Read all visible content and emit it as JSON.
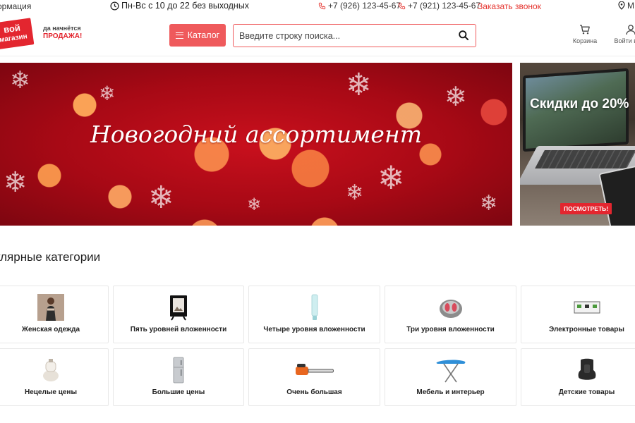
{
  "topbar": {
    "info_link": "ормация",
    "hours": "Пн-Вс с 10 до 22 без выходных",
    "phone1": "+7 (926) 123-45-67",
    "phone2": "+7 (921) 123-45-67",
    "callback": "Заказать звонок",
    "city": "М"
  },
  "header": {
    "logo_line1": "вой",
    "logo_line2": "магазин",
    "slogan_line1": "да начнётся",
    "slogan_line2": "продажа!",
    "catalog_label": "Каталог",
    "search_placeholder": "Введите строку поиска...",
    "cart_label": "Корзина",
    "login_label": "Войти в к"
  },
  "banners": {
    "main_title": "Новогодний ассортимент",
    "side_title": "Скидки до 20%",
    "side_button": "ПОСМОТРЕТЬ!"
  },
  "categories": {
    "title": "улярные категории",
    "items": [
      {
        "label": "Женская одежда",
        "icon": "dress-photo"
      },
      {
        "label": "Пять уровней вложенности",
        "icon": "photo-frame"
      },
      {
        "label": "Четыре уровня вложенности",
        "icon": "cream-tube"
      },
      {
        "label": "Три уровня вложенности",
        "icon": "foot-spa"
      },
      {
        "label": "Электронные товары",
        "icon": "router-device"
      },
      {
        "label": "Нецелые цены",
        "icon": "kitchen-mixer"
      },
      {
        "label": "Большие цены",
        "icon": "fridge"
      },
      {
        "label": "Очень большая",
        "icon": "chainsaw"
      },
      {
        "label": "Мебель и интерьер",
        "icon": "ironing-board"
      },
      {
        "label": "Детские товары",
        "icon": "car-seat"
      }
    ]
  },
  "colors": {
    "accent": "#ef5a5c",
    "brand_red": "#e3262f",
    "callback_link": "#e5322d"
  }
}
